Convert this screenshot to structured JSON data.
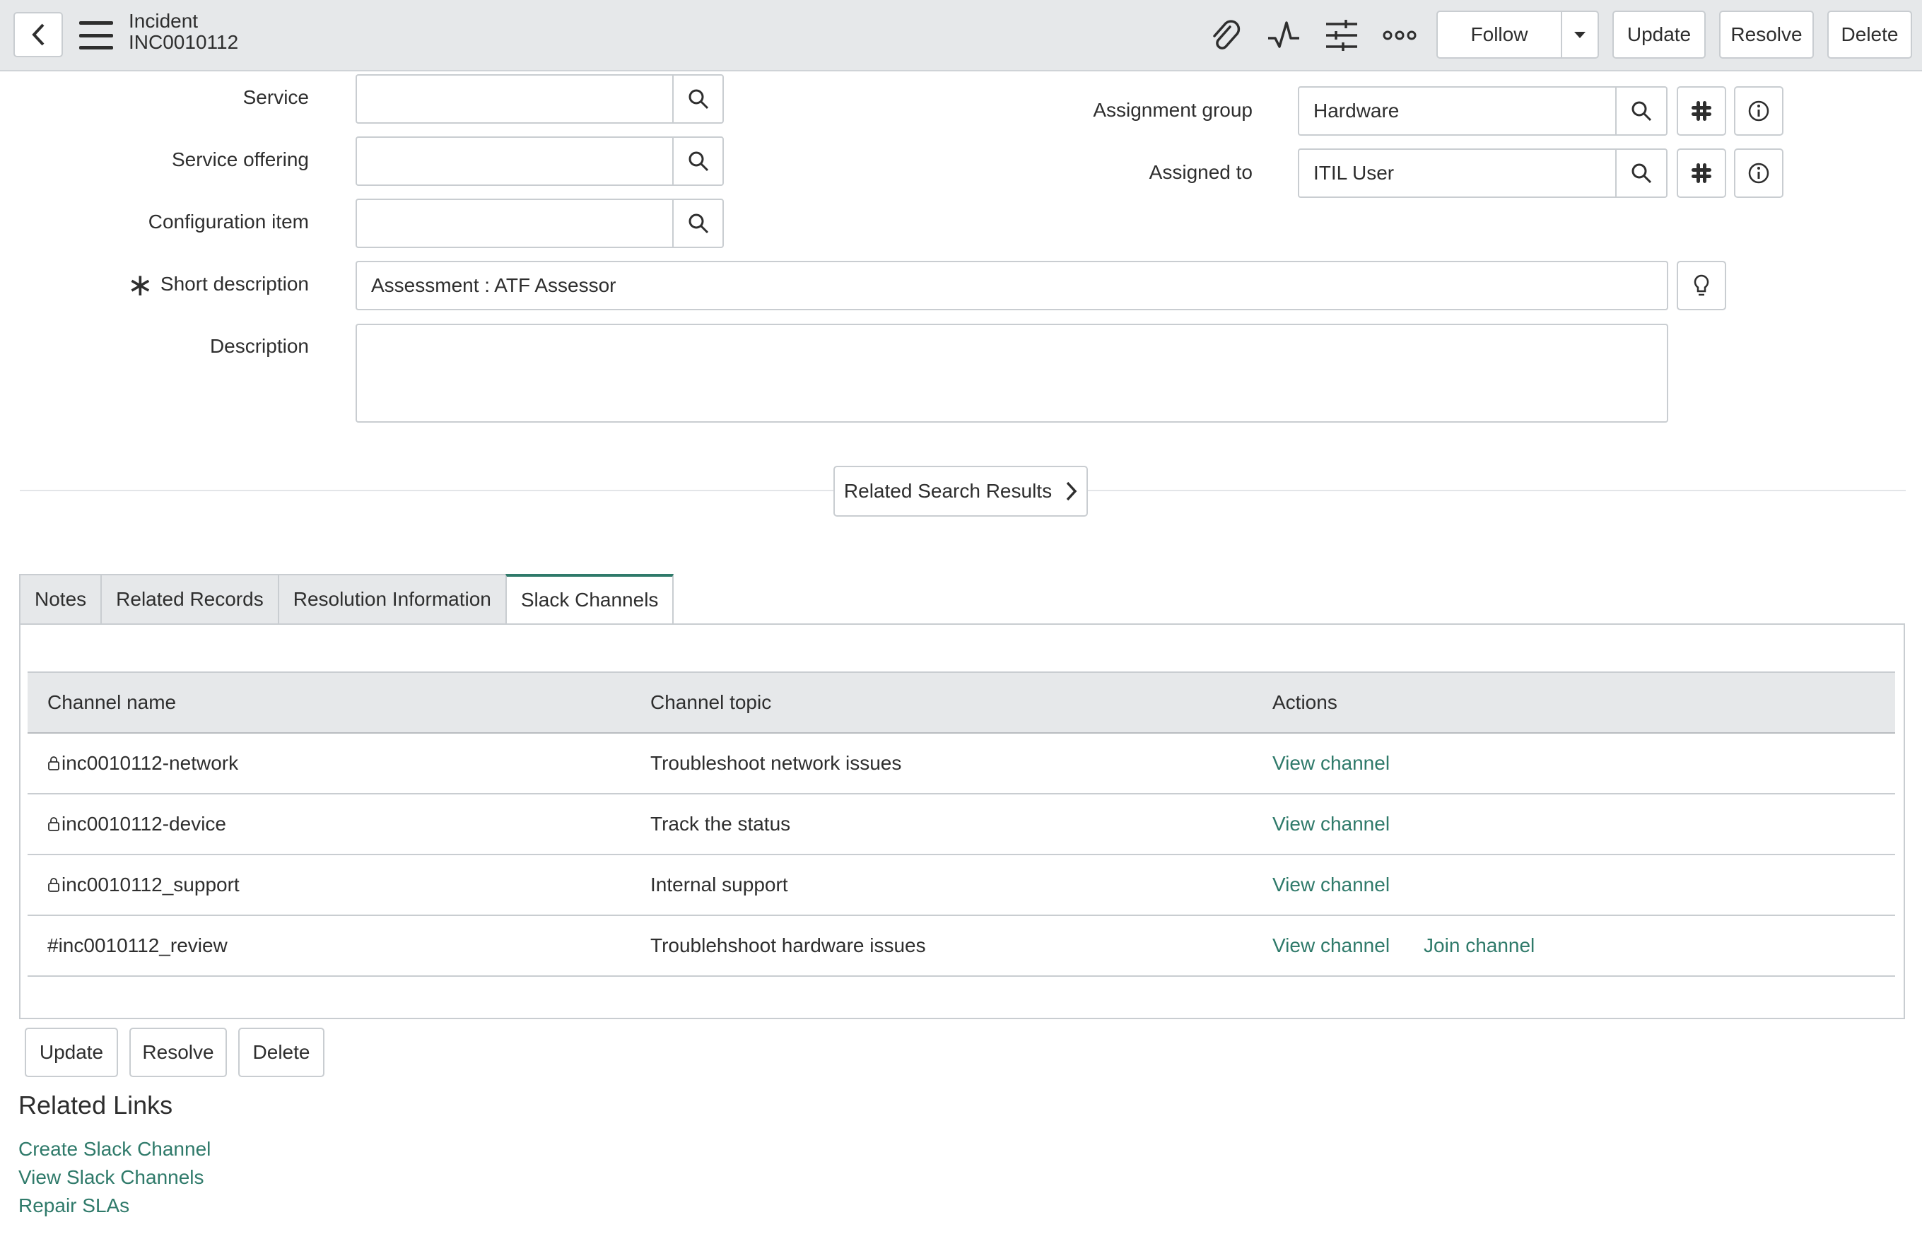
{
  "header": {
    "record_type": "Incident",
    "record_number": "INC0010112",
    "follow_label": "Follow",
    "update_label": "Update",
    "resolve_label": "Resolve",
    "delete_label": "Delete",
    "icons": [
      "back-arrow-icon",
      "hamburger-icon",
      "paperclip-icon",
      "activity-icon",
      "sliders-icon",
      "more-icon",
      "caret-down-icon"
    ]
  },
  "form": {
    "service_label": "Service",
    "service_value": "",
    "service_offering_label": "Service offering",
    "service_offering_value": "",
    "configuration_item_label": "Configuration item",
    "configuration_item_value": "",
    "short_description_label": "Short description",
    "short_description_value": "Assessment :  ATF Assessor",
    "description_label": "Description",
    "description_value": "",
    "assignment_group_label": "Assignment group",
    "assignment_group_value": "Hardware",
    "assigned_to_label": "Assigned to",
    "assigned_to_value": "ITIL User"
  },
  "related_search_label": "Related Search Results",
  "tabs": [
    {
      "label": "Notes",
      "active": false
    },
    {
      "label": "Related Records",
      "active": false
    },
    {
      "label": "Resolution Information",
      "active": false
    },
    {
      "label": "Slack Channels",
      "active": true
    }
  ],
  "slack_table": {
    "headers": [
      "Channel name",
      "Channel topic",
      "Actions"
    ],
    "rows": [
      {
        "name": "inc0010112-network",
        "private": true,
        "topic": "Troubleshoot network issues",
        "view": "View channel",
        "join": ""
      },
      {
        "name": "inc0010112-device",
        "private": true,
        "topic": "Track the status",
        "view": "View channel",
        "join": ""
      },
      {
        "name": "inc0010112_support",
        "private": true,
        "topic": "Internal support",
        "view": "View channel",
        "join": ""
      },
      {
        "name": "#inc0010112_review",
        "private": false,
        "topic": "Troublehshoot hardware issues",
        "view": "View channel",
        "join": "Join channel"
      }
    ]
  },
  "bottom_buttons": {
    "update": "Update",
    "resolve": "Resolve",
    "delete": "Delete"
  },
  "related_links": {
    "title": "Related Links",
    "links": [
      "Create Slack Channel",
      "View Slack Channels",
      "Repair SLAs"
    ]
  },
  "colors": {
    "accent": "#2f7a6a",
    "header_bg": "#e6e8ea",
    "border": "#c9cdd1"
  }
}
